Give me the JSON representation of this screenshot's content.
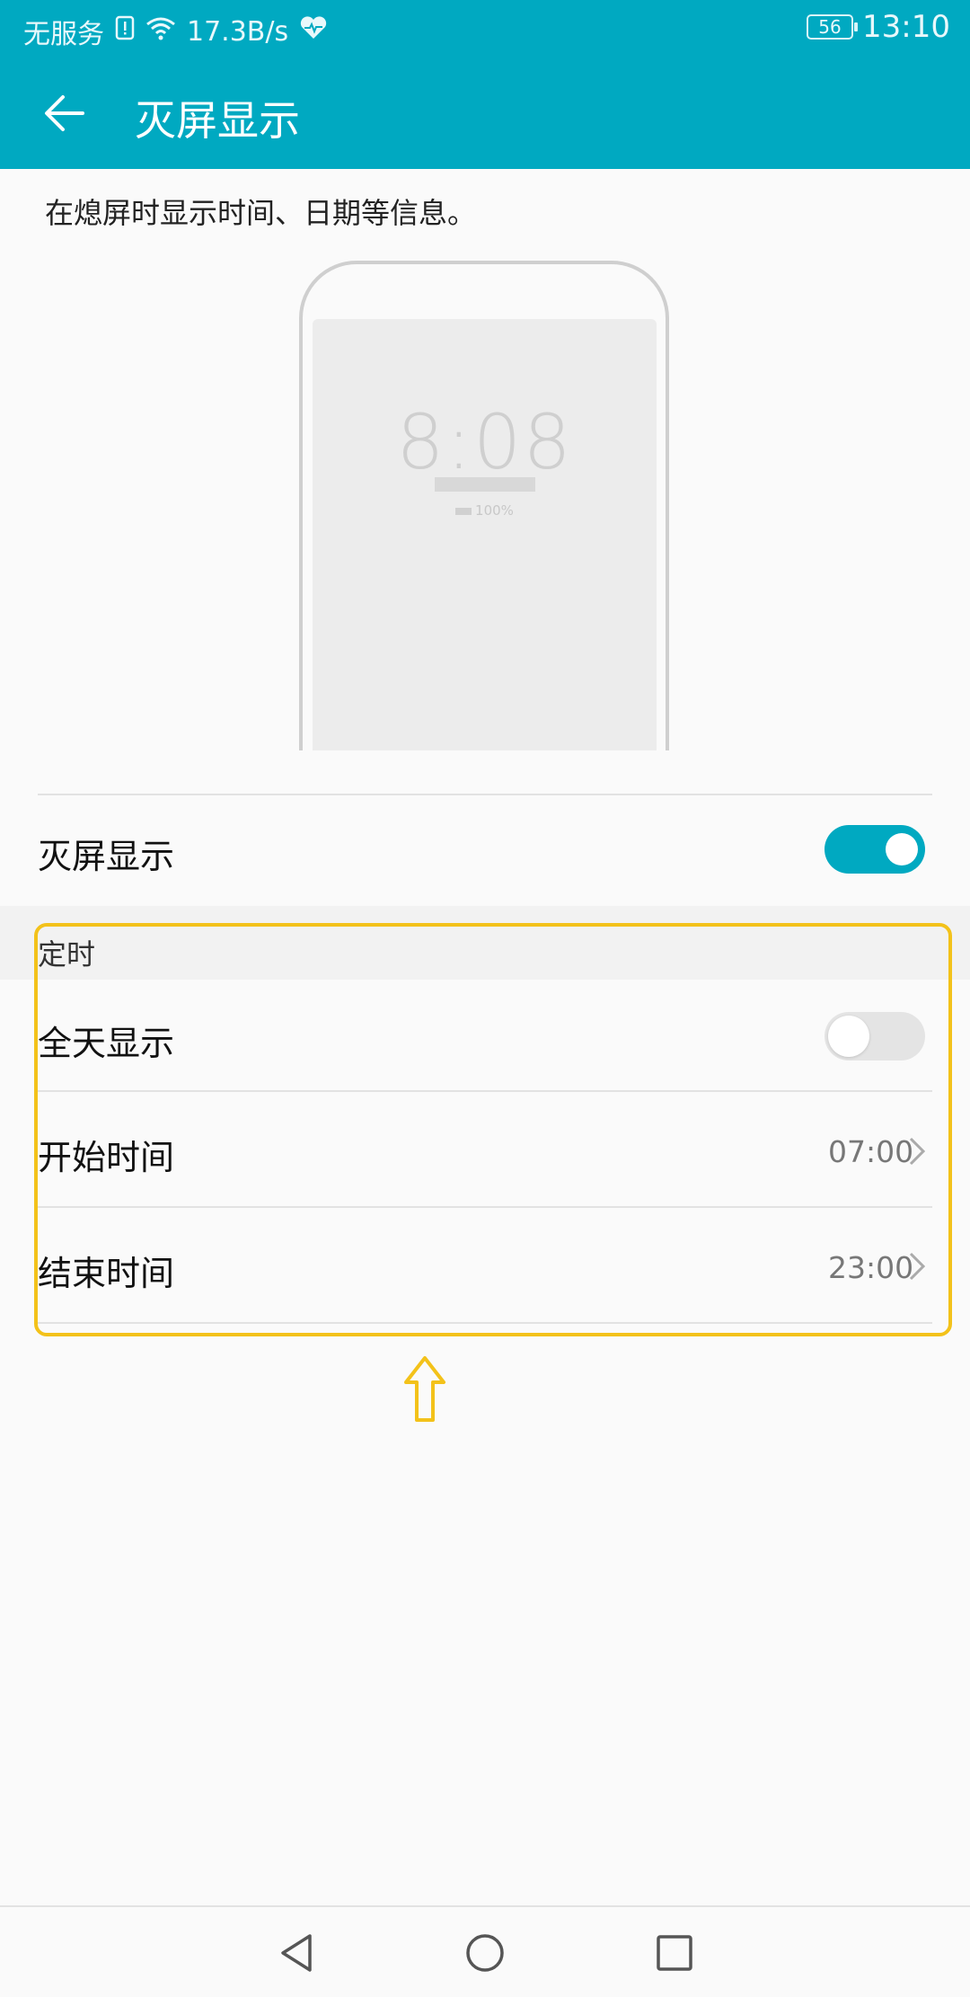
{
  "status_bar": {
    "carrier": "无服务",
    "network_speed": "17.3B/s",
    "battery_level": "56",
    "time": "13:10",
    "icons": [
      "sim-alert-icon",
      "wifi-icon",
      "health-heart-icon",
      "battery-icon"
    ]
  },
  "app_bar": {
    "title": "灭屏显示",
    "back_icon": "arrow-left-icon"
  },
  "description": "在熄屏时显示时间、日期等信息。",
  "preview": {
    "clock_time": "8:08",
    "battery_text": "100%"
  },
  "main_toggle": {
    "label": "灭屏显示",
    "on": true
  },
  "schedule_section": {
    "title": "定时",
    "all_day": {
      "label": "全天显示",
      "on": false
    },
    "start": {
      "label": "开始时间",
      "value": "07:00"
    },
    "end": {
      "label": "结束时间",
      "value": "23:00"
    }
  },
  "annotation": {
    "highlight_color": "#f3c21a",
    "arrow_icon": "up-arrow-icon"
  },
  "colors": {
    "accent": "#00a9c1",
    "background": "#fafafa"
  },
  "nav_bar": {
    "icons": [
      "back-triangle-icon",
      "home-circle-icon",
      "recents-square-icon"
    ]
  }
}
